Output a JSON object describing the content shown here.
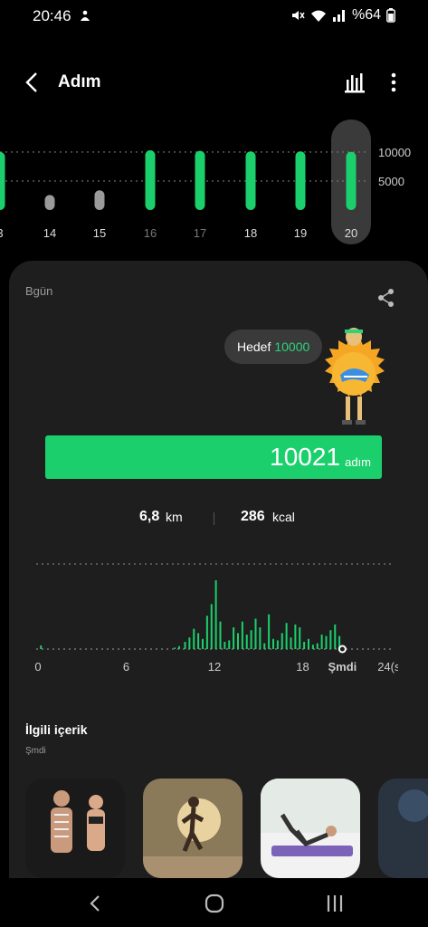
{
  "status": {
    "time": "20:46",
    "battery": "%64"
  },
  "appbar": {
    "title": "Adım"
  },
  "week": {
    "days": [
      "3",
      "14",
      "15",
      "16",
      "17",
      "18",
      "19",
      "20"
    ],
    "steps": [
      10000,
      2600,
      3400,
      10300,
      10200,
      10100,
      10100,
      10021
    ],
    "ref_lines": [
      "10000",
      "5000"
    ],
    "selected": "20"
  },
  "today": {
    "label": "Bgün",
    "goal_label": "Hedef",
    "goal_value": "10000",
    "steps": "10021",
    "steps_unit": "adım",
    "progress": 1.0,
    "distance": "6,8",
    "distance_unit": "km",
    "calories": "286",
    "calories_unit": "kcal"
  },
  "chart_data": {
    "type": "bar",
    "xlabels": [
      "0",
      "6",
      "12",
      "18",
      "Şmdi",
      "24(s)"
    ],
    "x_ticks": [
      0,
      6,
      12,
      18,
      20.7,
      24
    ],
    "xlim": [
      0,
      24
    ],
    "values": [
      [
        0.2,
        5
      ],
      [
        9.3,
        2
      ],
      [
        9.6,
        4
      ],
      [
        10.0,
        10
      ],
      [
        10.3,
        16
      ],
      [
        10.6,
        28
      ],
      [
        10.9,
        22
      ],
      [
        11.2,
        14
      ],
      [
        11.5,
        46
      ],
      [
        11.8,
        62
      ],
      [
        12.1,
        95
      ],
      [
        12.4,
        38
      ],
      [
        12.7,
        10
      ],
      [
        13.0,
        12
      ],
      [
        13.3,
        30
      ],
      [
        13.6,
        22
      ],
      [
        13.9,
        38
      ],
      [
        14.2,
        20
      ],
      [
        14.5,
        26
      ],
      [
        14.8,
        42
      ],
      [
        15.1,
        30
      ],
      [
        15.4,
        8
      ],
      [
        15.7,
        48
      ],
      [
        16.0,
        14
      ],
      [
        16.3,
        12
      ],
      [
        16.6,
        22
      ],
      [
        16.9,
        36
      ],
      [
        17.2,
        16
      ],
      [
        17.5,
        34
      ],
      [
        17.8,
        30
      ],
      [
        18.1,
        10
      ],
      [
        18.4,
        14
      ],
      [
        18.7,
        6
      ],
      [
        19.0,
        8
      ],
      [
        19.3,
        20
      ],
      [
        19.6,
        18
      ],
      [
        19.9,
        26
      ],
      [
        20.2,
        34
      ],
      [
        20.5,
        18
      ]
    ],
    "now": 20.7
  },
  "related": {
    "title": "İlgili içerik",
    "subtitle": "Şmdi"
  },
  "colors": {
    "accent": "#1bd06c",
    "card": "#1e1e1e",
    "bubble": "#3a3a3a"
  }
}
